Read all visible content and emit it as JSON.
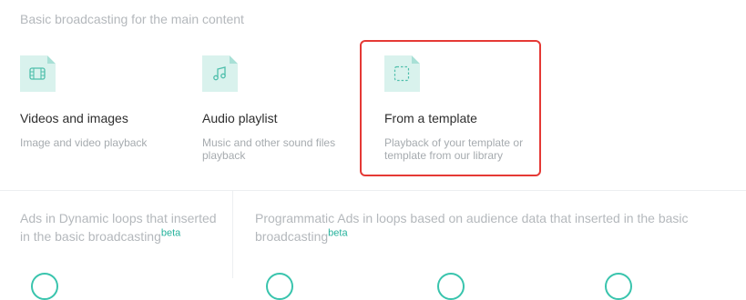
{
  "section_title": "Basic broadcasting for the main content",
  "cards": [
    {
      "title": "Videos and images",
      "desc": "Image and video playback",
      "icon": "film-icon"
    },
    {
      "title": "Audio playlist",
      "desc": "Music and other sound files playback",
      "icon": "music-note-icon"
    },
    {
      "title": "From a template",
      "desc": "Playback of your template or template from our library",
      "icon": "dashed-frame-icon"
    }
  ],
  "ads_dynamic": {
    "text": "Ads in Dynamic loops that inserted in the basic broadcasting",
    "badge": "beta"
  },
  "ads_programmatic": {
    "text": "Programmatic Ads in loops based on audience data that inserted in the basic broadcasting",
    "badge": "beta"
  },
  "colors": {
    "accent": "#25b29c",
    "icon_bg": "#d9f2ed",
    "highlight": "#e53935"
  }
}
